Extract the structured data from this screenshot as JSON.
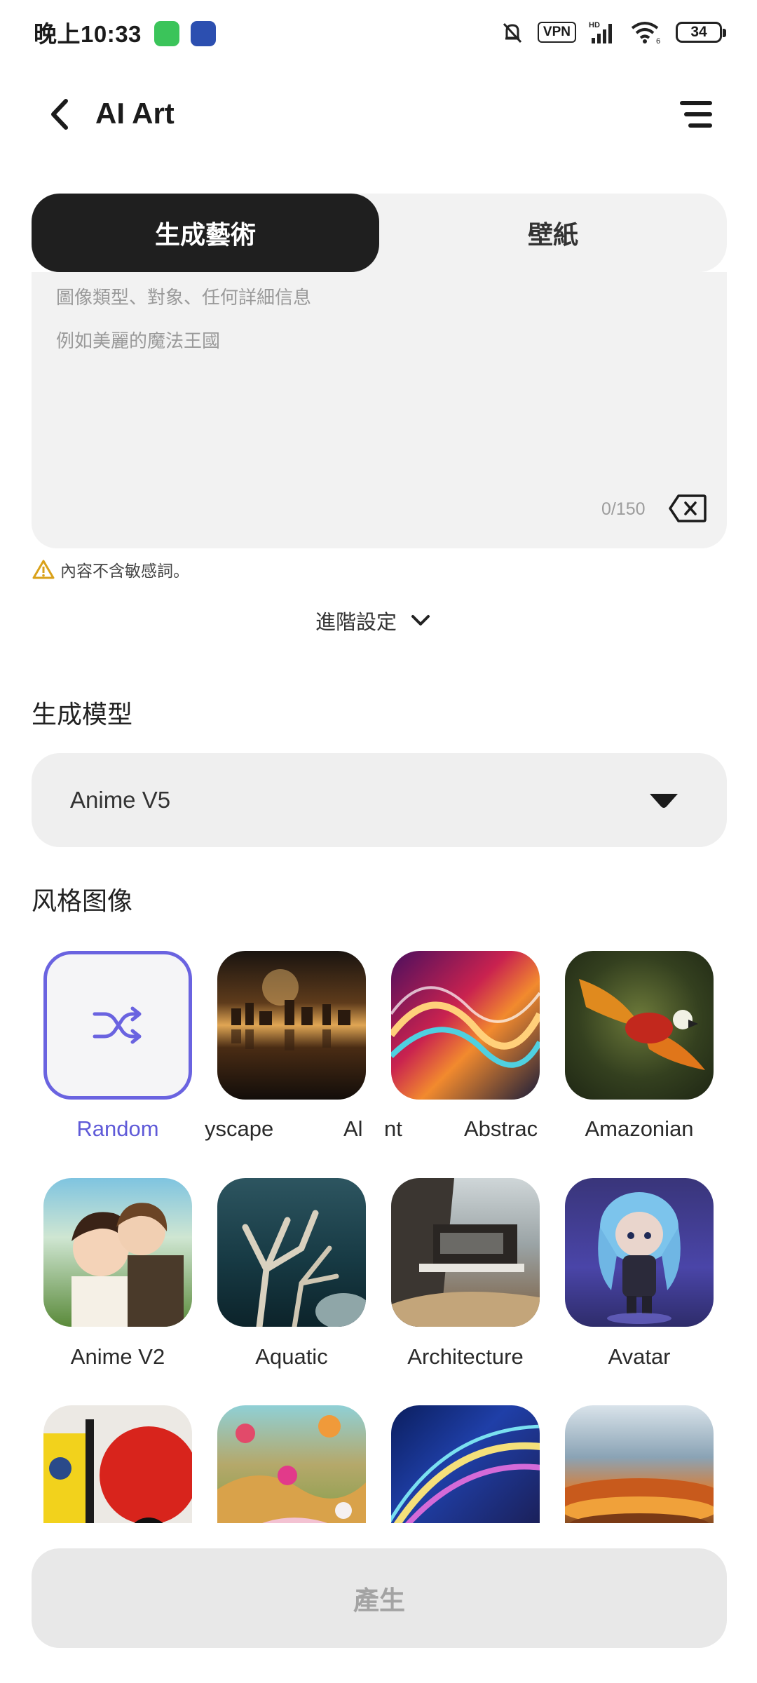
{
  "status_bar": {
    "time": "晚上10:33",
    "vpn": "VPN",
    "hd": "HD",
    "wifi_sub": "6",
    "battery": "34"
  },
  "header": {
    "title": "AI Art"
  },
  "tabs": [
    {
      "label": "生成藝術",
      "active": true
    },
    {
      "label": "壁紙",
      "active": false
    }
  ],
  "prompt": {
    "placeholder_line1": "圖像類型、對象、任何詳細信息",
    "placeholder_line2": "例如美麗的魔法王國",
    "counter": "0/150"
  },
  "warning": "內容不含敏感詞。",
  "advanced_settings": "進階設定",
  "model_section": {
    "title": "生成模型",
    "selected": "Anime V5"
  },
  "style_section": {
    "title": "风格图像",
    "items": [
      {
        "label": "Random",
        "selected": true
      },
      {
        "label": "yscape"
      },
      {
        "label": "Al"
      },
      {
        "label": "nt"
      },
      {
        "label": "Abstrac"
      },
      {
        "label": "Amazonian"
      },
      {
        "label": "Anime V2"
      },
      {
        "label": "Aquatic"
      },
      {
        "label": "Architecture"
      },
      {
        "label": "Avatar"
      }
    ]
  },
  "generate_button": "產生",
  "colors": {
    "accent": "#6a63e0",
    "tab_active_bg": "#1f1f1f",
    "panel_bg": "#f2f2f2"
  }
}
